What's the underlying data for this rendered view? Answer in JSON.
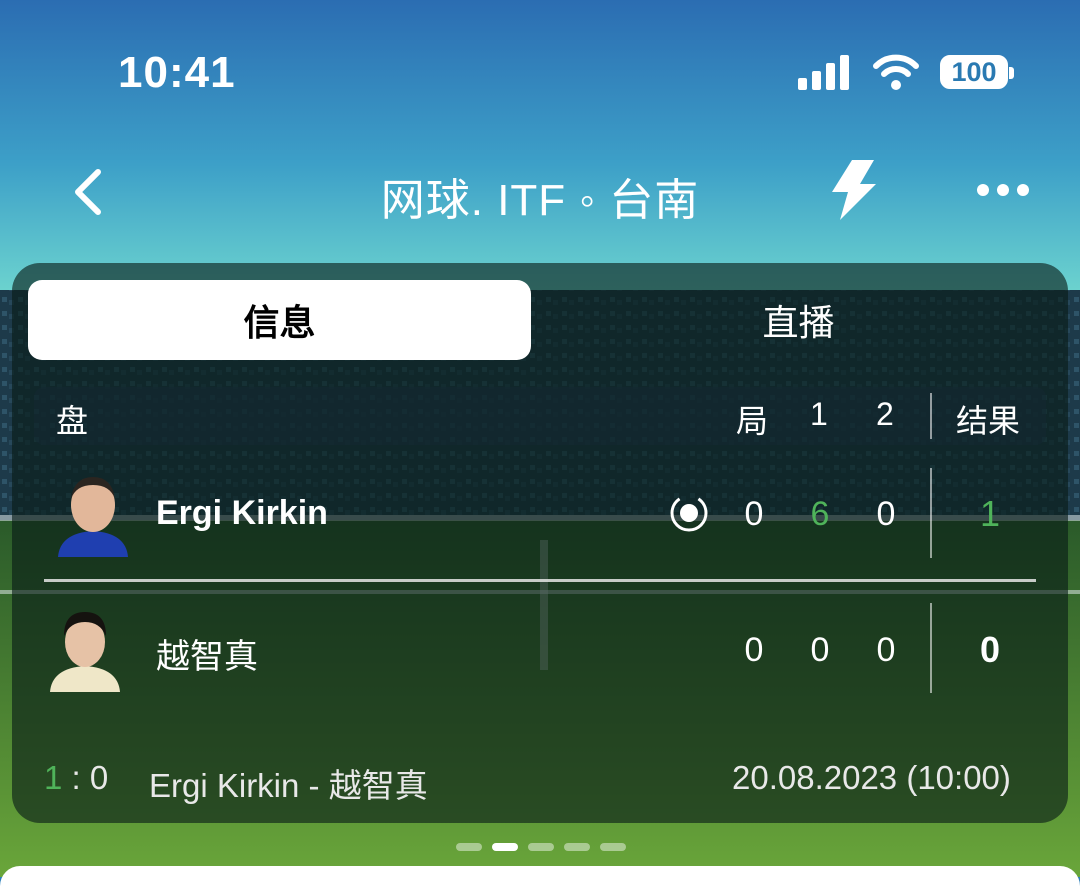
{
  "status_bar": {
    "time": "10:41",
    "battery": "100"
  },
  "nav": {
    "title": "网球. ITF ◦  台南"
  },
  "tabs": [
    {
      "label": "信息",
      "active": true
    },
    {
      "label": "直播",
      "active": false
    }
  ],
  "table": {
    "header": {
      "set_label": "盘",
      "game_label": "局",
      "set1": "1",
      "set2": "2",
      "result_label": "结果"
    },
    "players": [
      {
        "name": "Ergi Kirkin",
        "serving": true,
        "game": "0",
        "set1": "6",
        "set2": "0",
        "result": "1"
      },
      {
        "name": "越智真",
        "serving": false,
        "game": "0",
        "set1": "0",
        "set2": "0",
        "result": "0"
      }
    ]
  },
  "summary": {
    "score_left": "1",
    "score_sep": ":",
    "score_right": "0",
    "matchup": "Ergi Kirkin - 越智真",
    "datetime": "20.08.2023 (10:00)"
  },
  "pager": {
    "count": 5,
    "active_index": 1
  },
  "colors": {
    "accent_green": "#4fb35a",
    "sky_top": "#2a6fb3",
    "sky_bottom": "#5fd0cc",
    "pitch": "#2f6a2a"
  },
  "icons": [
    "back-icon",
    "bolt-icon",
    "more-icon",
    "signal-icon",
    "wifi-icon",
    "battery-icon",
    "serve-indicator-icon"
  ]
}
